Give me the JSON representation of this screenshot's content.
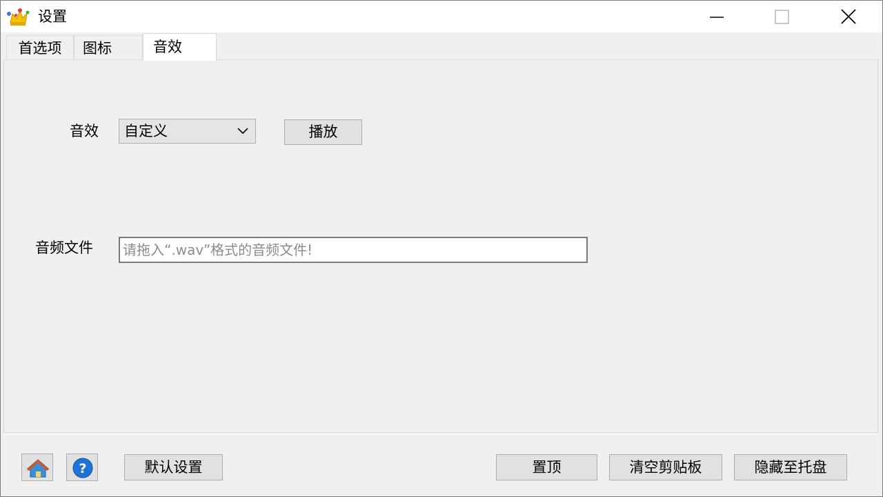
{
  "window": {
    "title": "设置",
    "icon": "crown-icon",
    "controls": [
      "minimize-icon",
      "maximize-icon",
      "close-icon"
    ]
  },
  "tabs": [
    {
      "label": "首选项",
      "active": false
    },
    {
      "label": "图标",
      "active": false
    },
    {
      "label": "音效",
      "active": true
    }
  ],
  "sound": {
    "label": "音效",
    "selected": "自定义",
    "play_label": "播放"
  },
  "file": {
    "label": "音频文件",
    "placeholder": "请拖入“.wav”格式的音频文件!",
    "value": ""
  },
  "bottom": {
    "home_icon": "home-icon",
    "help_icon": "help-icon",
    "default_label": "默认设置",
    "top_label": "置顶",
    "clear_label": "清空剪贴板",
    "hide_label": "隐藏至托盘"
  },
  "colors": {
    "window_bg": "#f0f0f0",
    "titlebar_bg": "#ffffff",
    "button_bg": "#e1e1e1",
    "help_blue": "#1e73d8"
  }
}
